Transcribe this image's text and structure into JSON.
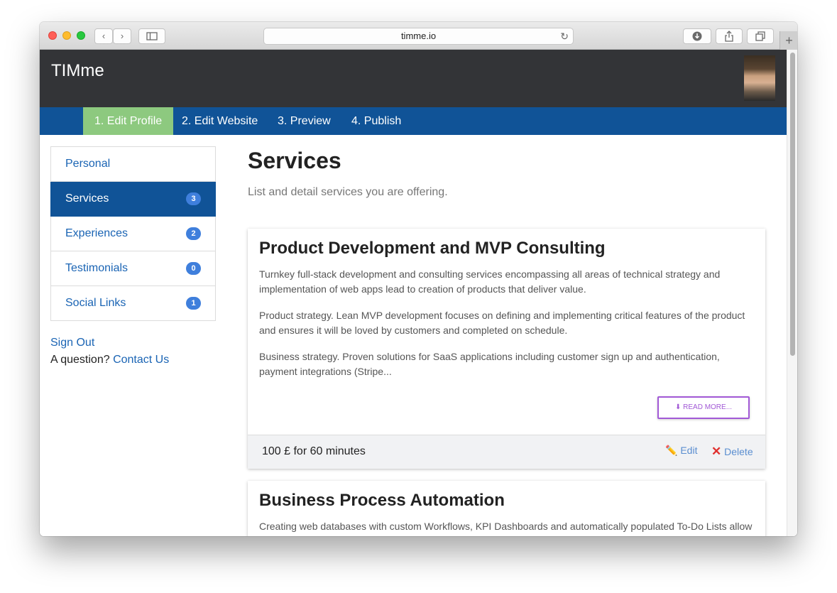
{
  "browser": {
    "url": "timme.io",
    "back_glyph": "‹",
    "forward_glyph": "›",
    "new_tab_glyph": "+"
  },
  "app": {
    "brand": "TIMme",
    "steps": [
      {
        "label": "1. Edit Profile",
        "active": true
      },
      {
        "label": "2. Edit Website",
        "active": false
      },
      {
        "label": "3. Preview",
        "active": false
      },
      {
        "label": "4. Publish",
        "active": false
      }
    ]
  },
  "sidebar": {
    "items": [
      {
        "label": "Personal",
        "count": ""
      },
      {
        "label": "Services",
        "count": "3"
      },
      {
        "label": "Experiences",
        "count": "2"
      },
      {
        "label": "Testimonials",
        "count": "0"
      },
      {
        "label": "Social Links",
        "count": "1"
      }
    ],
    "sign_out": "Sign Out",
    "question": "A question?",
    "contact": "Contact Us"
  },
  "main": {
    "title": "Services",
    "subtitle": "List and detail services you are offering.",
    "cards": [
      {
        "title": "Product Development and MVP Consulting",
        "paragraphs": [
          "Turnkey full-stack development and consulting services encompassing all areas of technical strategy and implementation of web apps lead to creation of products that deliver value.",
          "Product strategy. Lean MVP development focuses on defining and implementing critical features of the product and ensures it will be loved by customers and completed on schedule.",
          "Business strategy. Proven solutions for SaaS applications including customer sign up and authentication, payment integrations (Stripe..."
        ],
        "read_more": "⬇ READ MORE...",
        "price": "100 £ for 60 minutes",
        "edit": "Edit",
        "delete": "Delete"
      },
      {
        "title": "Business Process Automation",
        "paragraphs": [
          "Creating web databases with custom Workflows, KPI Dashboards and automatically populated To-Do Lists allow to grasp the full picture of business operations, ensure data integrity and encourage business processes in the organization."
        ]
      }
    ]
  },
  "colors": {
    "appbar": "#333437",
    "stepsbar": "#105397",
    "active_step": "#8dc97f",
    "link": "#1a64b4",
    "badge": "#3f7fdc",
    "read_more": "#a259d6"
  }
}
